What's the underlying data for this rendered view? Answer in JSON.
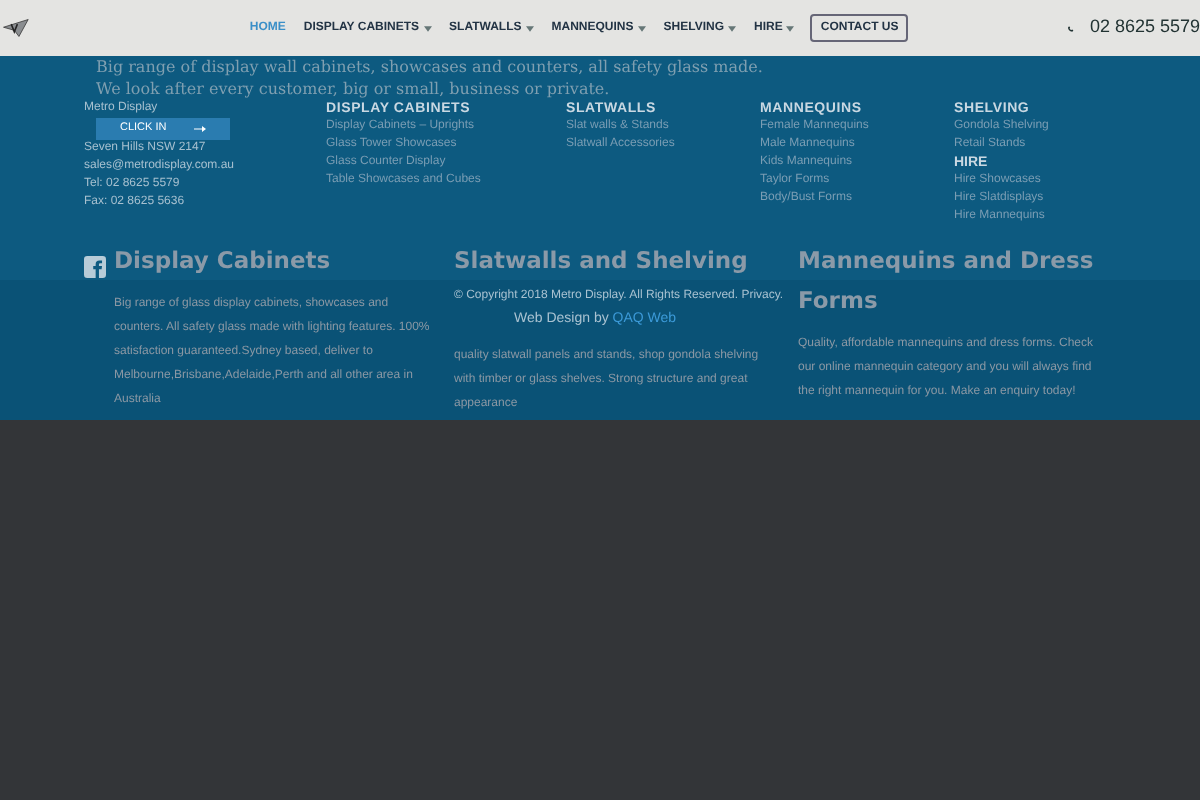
{
  "header": {
    "nav": [
      {
        "label": "HOME",
        "selected": true,
        "has_menu": false
      },
      {
        "label": "DISPLAY CABINETS",
        "selected": false,
        "has_menu": true
      },
      {
        "label": "SLATWALLS",
        "selected": false,
        "has_menu": true
      },
      {
        "label": "MANNEQUINS",
        "selected": false,
        "has_menu": true
      },
      {
        "label": "SHELVING",
        "selected": false,
        "has_menu": true
      },
      {
        "label": "HIRE",
        "selected": false,
        "has_menu": true
      }
    ],
    "contact_button": "CONTACT US",
    "phone": "02 8625 5579"
  },
  "intro": [
    "Big range of display wall cabinets, showcases and counters, all safety glass made.",
    "We look after every customer, big or small, business or private."
  ],
  "contact": {
    "company": "Metro Display",
    "click_in": "CLICK IN",
    "suburb": "Seven Hills NSW 2147",
    "email": "sales@metrodisplay.com.au",
    "tel": "Tel: 02 8625 5579",
    "fax": "Fax: 02 8625 5636"
  },
  "footer_columns": [
    {
      "heading": "DISPLAY CABINETS",
      "links": [
        "Display Cabinets – Uprights",
        "Glass Tower Showcases",
        "Glass Counter Display",
        "Table Showcases and Cubes"
      ]
    },
    {
      "heading": "SLATWALLS",
      "links": [
        "Slat walls & Stands",
        "Slatwall Accessories"
      ]
    },
    {
      "heading": "MANNEQUINS",
      "links": [
        "Female Mannequins",
        "Male Mannequins",
        "Kids Mannequins",
        "Taylor Forms",
        "Body/Bust Forms"
      ]
    },
    {
      "heading": "SHELVING",
      "links": [
        "Gondola Shelving",
        "Retail Stands"
      ],
      "sub_heading": "HIRE",
      "sub_links": [
        "Hire Showcases",
        "Hire Slatdisplays",
        "Hire Mannequins"
      ]
    }
  ],
  "sections": [
    {
      "title": "Display Cabinets",
      "text": "Big range of glass display cabinets, showcases and counters. All safety glass made with lighting features. 100% satisfaction guaranteed.Sydney based, deliver to Melbourne,Brisbane,Adelaide,Perth and all other area in Australia"
    },
    {
      "title": "Slatwalls and Shelving",
      "text": "quality slatwall panels and stands, shop gondola shelving with timber or glass shelves. Strong structure and great appearance"
    },
    {
      "title": "Mannequins and Dress Forms",
      "text": "Quality, affordable mannequins and dress forms. Check our online mannequin category and you will always find the right mannequin for you. Make an enquiry today!"
    }
  ],
  "copyright": "© Copyright 2018 Metro Display. All Rights Reserved. Privacy.",
  "web_design": "Web Design by",
  "web_design_link": "QAQ Web"
}
